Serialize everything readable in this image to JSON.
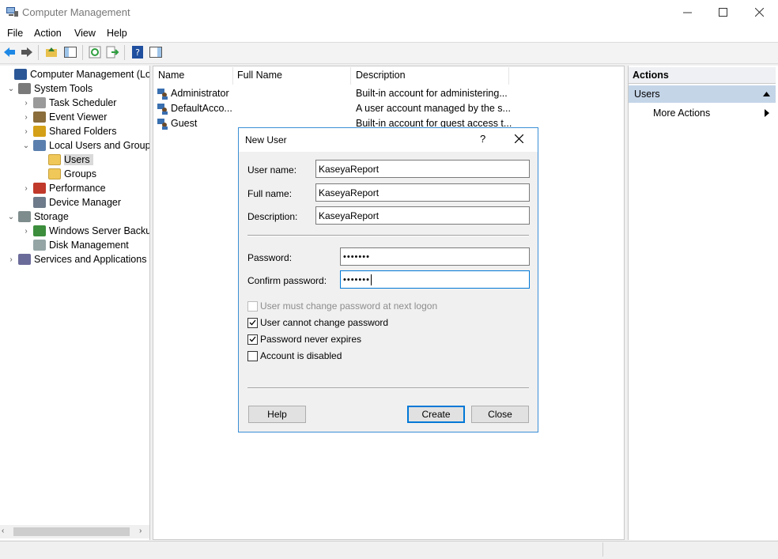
{
  "window": {
    "title": "Computer Management"
  },
  "menu": [
    "File",
    "Action",
    "View",
    "Help"
  ],
  "tree": [
    {
      "label": "Computer Management (Local",
      "indent": 0,
      "chevron": "",
      "icon": "computer-management-icon"
    },
    {
      "label": "System Tools",
      "indent": 1,
      "chevron": "⌄",
      "icon": "system-tools-icon"
    },
    {
      "label": "Task Scheduler",
      "indent": 2,
      "chevron": "›",
      "icon": "clock-icon"
    },
    {
      "label": "Event Viewer",
      "indent": 2,
      "chevron": "›",
      "icon": "event-viewer-icon"
    },
    {
      "label": "Shared Folders",
      "indent": 2,
      "chevron": "›",
      "icon": "shared-folder-icon"
    },
    {
      "label": "Local Users and Groups",
      "indent": 2,
      "chevron": "⌄",
      "icon": "users-groups-icon"
    },
    {
      "label": "Users",
      "indent": 3,
      "chevron": "",
      "icon": "folder-icon",
      "selected": true
    },
    {
      "label": "Groups",
      "indent": 3,
      "chevron": "",
      "icon": "folder-icon"
    },
    {
      "label": "Performance",
      "indent": 2,
      "chevron": "›",
      "icon": "performance-icon"
    },
    {
      "label": "Device Manager",
      "indent": 2,
      "chevron": "",
      "icon": "device-manager-icon"
    },
    {
      "label": "Storage",
      "indent": 1,
      "chevron": "⌄",
      "icon": "storage-icon"
    },
    {
      "label": "Windows Server Backup",
      "indent": 2,
      "chevron": "›",
      "icon": "backup-icon"
    },
    {
      "label": "Disk Management",
      "indent": 2,
      "chevron": "",
      "icon": "disk-icon"
    },
    {
      "label": "Services and Applications",
      "indent": 1,
      "chevron": "›",
      "icon": "services-icon"
    }
  ],
  "list": {
    "columns": [
      "Name",
      "Full Name",
      "Description"
    ],
    "rows": [
      {
        "name": "Administrator",
        "full_name": "",
        "description": "Built-in account for administering..."
      },
      {
        "name": "DefaultAcco...",
        "full_name": "",
        "description": "A user account managed by the s..."
      },
      {
        "name": "Guest",
        "full_name": "",
        "description": "Built-in account for guest access t..."
      }
    ]
  },
  "actions": {
    "header": "Actions",
    "section": "Users",
    "more": "More Actions"
  },
  "dialog": {
    "title": "New User",
    "help_glyph": "?",
    "username_label": "User name:",
    "username_value": "KaseyaReport",
    "fullname_label": "Full name:",
    "fullname_value": "KaseyaReport",
    "description_label": "Description:",
    "description_value": "KaseyaReport",
    "password_label": "Password:",
    "password_value": "•••••••",
    "confirm_label": "Confirm password:",
    "confirm_value": "•••••••",
    "checks": [
      {
        "label": "User must change password at next logon",
        "checked": false,
        "disabled": true
      },
      {
        "label": "User cannot change password",
        "checked": true,
        "disabled": false
      },
      {
        "label": "Password never expires",
        "checked": true,
        "disabled": false
      },
      {
        "label": "Account is disabled",
        "checked": false,
        "disabled": false
      }
    ],
    "help_button": "Help",
    "create_button": "Create",
    "close_button": "Close"
  },
  "colors": {
    "accent": "#0078d7",
    "selection": "#d9d9d9",
    "actions_band": "#c4d5e8"
  }
}
